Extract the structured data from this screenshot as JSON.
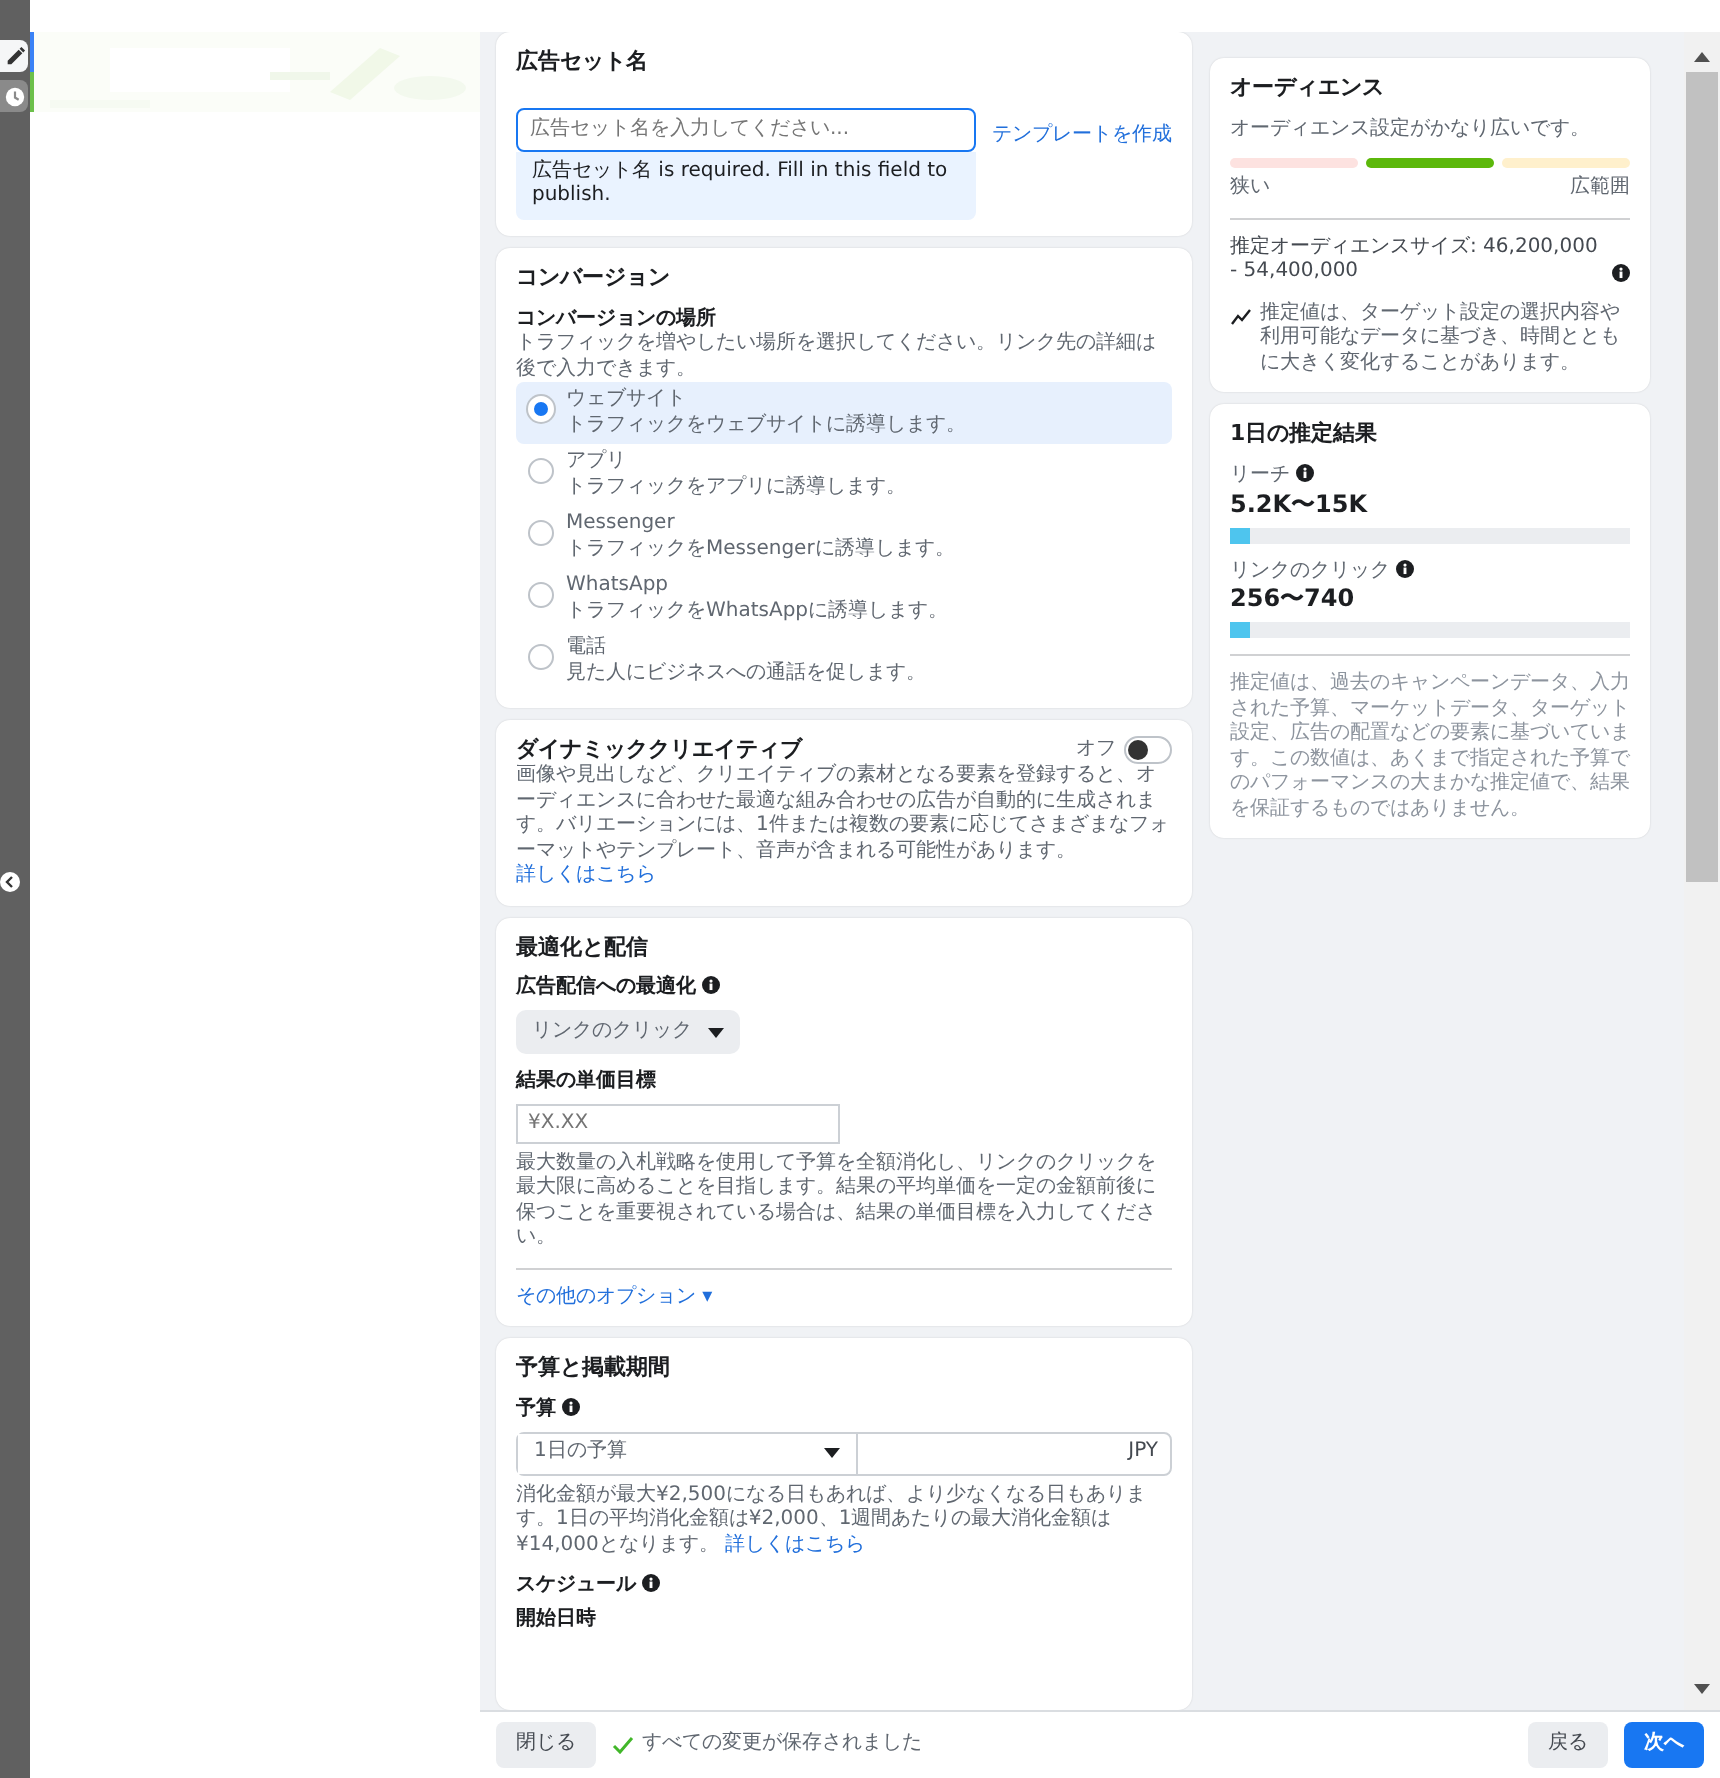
{
  "tool_rail": [
    {
      "kind": "edit",
      "selected": true
    },
    {
      "kind": "history",
      "selected": false
    }
  ],
  "ad_set_name": {
    "title": "広告セット名",
    "placeholder": "広告セット名を入力してください...",
    "template_link": "テンプレートを作成",
    "error": "広告セット名 is required. Fill in this field to publish."
  },
  "conversion": {
    "title": "コンバージョン",
    "location_label": "コンバージョンの場所",
    "location_help": "トラフィックを増やしたい場所を選択してください。リンク先の詳細は後で入力できます。",
    "options": [
      {
        "label": "ウェブサイト",
        "description": "トラフィックをウェブサイトに誘導します。",
        "selected": true
      },
      {
        "label": "アプリ",
        "description": "トラフィックをアプリに誘導します。",
        "selected": false
      },
      {
        "label": "Messenger",
        "description": "トラフィックをMessengerに誘導します。",
        "selected": false
      },
      {
        "label": "WhatsApp",
        "description": "トラフィックをWhatsAppに誘導します。",
        "selected": false
      },
      {
        "label": "電話",
        "description": "見た人にビジネスへの通話を促します。",
        "selected": false
      }
    ]
  },
  "dynamic_creative": {
    "title": "ダイナミッククリエイティブ",
    "toggle_label": "オフ",
    "on": false,
    "description": "画像や見出しなど、クリエイティブの素材となる要素を登録すると、オーディエンスに合わせた最適な組み合わせの広告が自動的に生成されます。バリエーションには、1件または複数の要素に応じてさまざまなフォーマットやテンプレート、音声が含まれる可能性があります。",
    "link": "詳しくはこちら"
  },
  "optimization": {
    "title": "最適化と配信",
    "delivery_label": "広告配信への最適化",
    "delivery_value": "リンクのクリック",
    "cost_label": "結果の単価目標",
    "cost_placeholder": "¥X.XX",
    "help": "最大数量の入札戦略を使用して予算を全額消化し、リンクのクリックを最大限に高めることを目指します。結果の平均単価を一定の金額前後に保つことを重要視されている場合は、結果の単価目標を入力してください。",
    "more_options": "その他のオプション ▾"
  },
  "budget": {
    "title": "予算と掲載期間",
    "budget_label": "予算",
    "budget_type": "1日の予算",
    "currency": "JPY",
    "help": "消化金額が最大¥2,500になる日もあれば、より少なくなる日もあります。1日の平均消化金額は¥2,000、1週間あたりの最大消化金額は¥14,000となります。",
    "link": "詳しくはこちら",
    "schedule_label": "スケジュール",
    "start_label": "開始日時"
  },
  "audience": {
    "title": "オーディエンス",
    "summary": "オーディエンス設定がかなり広いです。",
    "segments": [
      {
        "selected": false
      },
      {
        "selected": true
      },
      {
        "selected": false
      }
    ],
    "narrow_label": "狭い",
    "broad_label": "広範囲",
    "size": "推定オーディエンスサイズ: 46,200,000 - 54,400,000",
    "note": "推定値は、ターゲット設定の選択内容や利用可能なデータに基づき、時間とともに大きく変化することがあります。"
  },
  "daily_results": {
    "title": "1日の推定結果",
    "metrics": [
      {
        "label": "リーチ",
        "value": "5.2K〜15K",
        "level": 0.05
      },
      {
        "label": "リンクのクリック",
        "value": "256〜740",
        "level": 0.05
      }
    ],
    "disclaimer": "推定値は、過去のキャンペーンデータ、入力された予算、マーケットデータ、ターゲット設定、広告の配置などの要素に基づいています。この数値は、あくまで指定された予算でのパフォーマンスの大まかな推定値で、結果を保証するものではありません。"
  },
  "footer": {
    "close": "閉じる",
    "status": "すべての変更が保存されました",
    "back": "戻る",
    "next": "次へ"
  }
}
